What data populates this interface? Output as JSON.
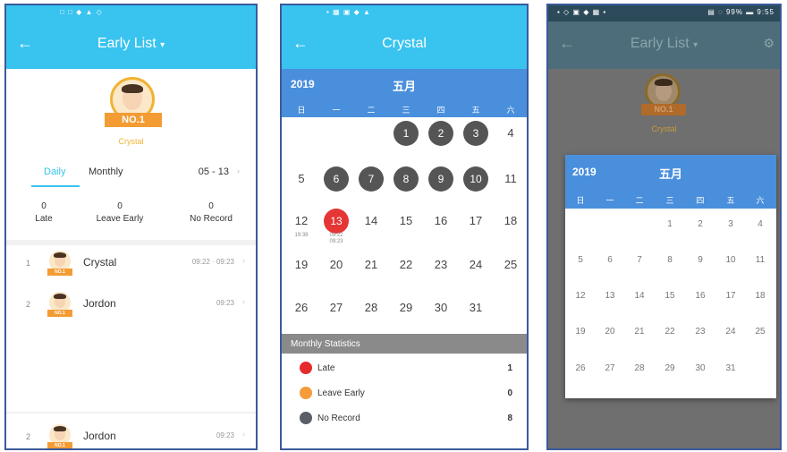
{
  "screen1": {
    "statusbar": "□ □ ◆ ▲ ◇",
    "title": "Early List",
    "title_caret": "▾",
    "back": "←",
    "badge_text": "NO.1",
    "champion_name": "Crystal",
    "tabs": [
      "Daily",
      "Monthly"
    ],
    "date": "05 - 13",
    "date_chevron": "›",
    "stats": [
      {
        "value": "0",
        "label": "Late"
      },
      {
        "value": "0",
        "label": "Leave Early"
      },
      {
        "value": "0",
        "label": "No Record"
      }
    ],
    "rows": [
      {
        "rank": "1",
        "name": "Crystal",
        "time": "09:22 · 09:23"
      },
      {
        "rank": "2",
        "name": "Jordon",
        "time": "09:23"
      },
      {
        "rank": "2",
        "name": "Jordon",
        "time": "09:23"
      }
    ],
    "row_chevron": "›",
    "mini_badge": "NO.1"
  },
  "screen2": {
    "statusbar": "▪ ▦ ▣ ◆ ▲",
    "title": "Crystal",
    "back": "←",
    "year": "2019",
    "month": "五月",
    "weekdays": [
      "日",
      "一",
      "二",
      "三",
      "四",
      "五",
      "六"
    ],
    "weeks": [
      [
        "",
        "",
        "",
        "1",
        "2",
        "3",
        "4"
      ],
      [
        "5",
        "6",
        "7",
        "8",
        "9",
        "10",
        "11"
      ],
      [
        "12",
        "13",
        "14",
        "15",
        "16",
        "17",
        "18"
      ],
      [
        "19",
        "20",
        "21",
        "22",
        "23",
        "24",
        "25"
      ],
      [
        "26",
        "27",
        "28",
        "29",
        "30",
        "31",
        ""
      ]
    ],
    "sub_12": "19:39",
    "sub_13": "09:22 09:23",
    "monthly_statistics": "Monthly Statistics",
    "legend": [
      {
        "label": "Late",
        "value": "1",
        "color": "#e52b2b"
      },
      {
        "label": "Leave Early",
        "value": "0",
        "color": "#f59b38"
      },
      {
        "label": "No Record",
        "value": "8",
        "color": "#5a5e66"
      }
    ]
  },
  "screen3": {
    "statusbar_left": "▪ ◇ ▣ ◆ ▦ ▪",
    "statusbar_right": "▤ ◌ 99% ▬ 9:55",
    "title": "Early List",
    "title_caret": "▾",
    "back": "←",
    "gear": "⚙",
    "badge_text": "NO.1",
    "champion_name": "Crystal",
    "year": "2019",
    "month": "五月",
    "weekdays": [
      "日",
      "一",
      "二",
      "三",
      "四",
      "五",
      "六"
    ],
    "weeks": [
      [
        "",
        "",
        "",
        "1",
        "2",
        "3",
        "4"
      ],
      [
        "5",
        "6",
        "7",
        "8",
        "9",
        "10",
        "11"
      ],
      [
        "12",
        "13",
        "14",
        "15",
        "16",
        "17",
        "18"
      ],
      [
        "19",
        "20",
        "21",
        "22",
        "23",
        "24",
        "25"
      ],
      [
        "26",
        "27",
        "28",
        "29",
        "30",
        "31",
        ""
      ]
    ]
  }
}
